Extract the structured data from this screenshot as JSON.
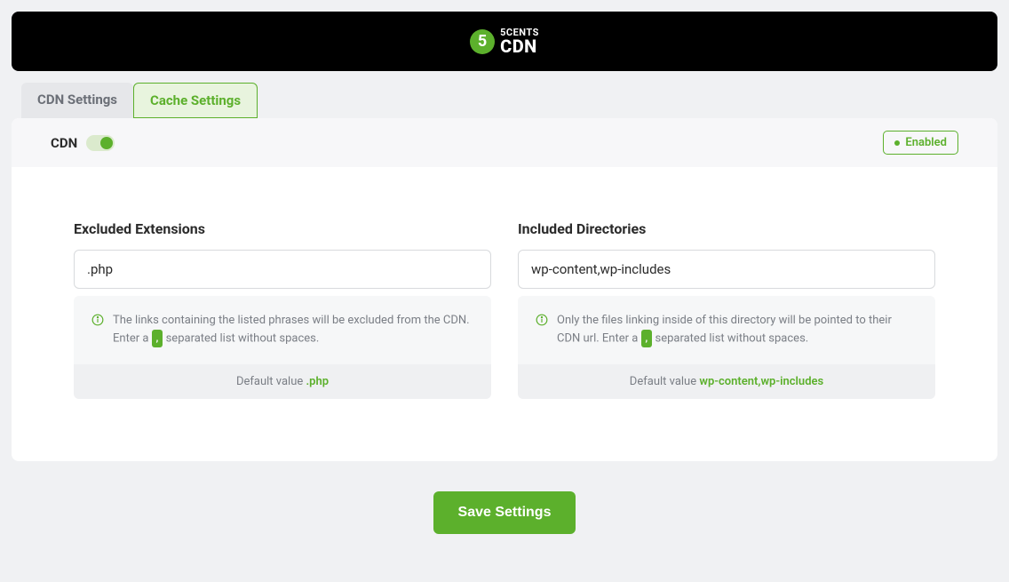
{
  "brand": {
    "glyph": "5",
    "top": "5CENTS",
    "bottom": "CDN"
  },
  "tabs": {
    "cdn_settings": "CDN Settings",
    "cache_settings": "Cache Settings"
  },
  "panel_header": {
    "cdn_label": "CDN",
    "status_label": "Enabled"
  },
  "fields": {
    "excluded": {
      "label": "Excluded Extensions",
      "value": ".php",
      "help_pre": "The links containing the listed phrases will be excluded from the CDN. Enter a ",
      "help_chip": ",",
      "help_post": " separated list without spaces.",
      "default_label": "Default value ",
      "default_value": ".php"
    },
    "included": {
      "label": "Included Directories",
      "value": "wp-content,wp-includes",
      "help_pre": "Only the files linking inside of this directory will be pointed to their CDN url. Enter a ",
      "help_chip": ",",
      "help_post": " separated list without spaces.",
      "default_label": "Default value ",
      "default_value": "wp-content,wp-includes"
    }
  },
  "actions": {
    "save": "Save Settings"
  }
}
